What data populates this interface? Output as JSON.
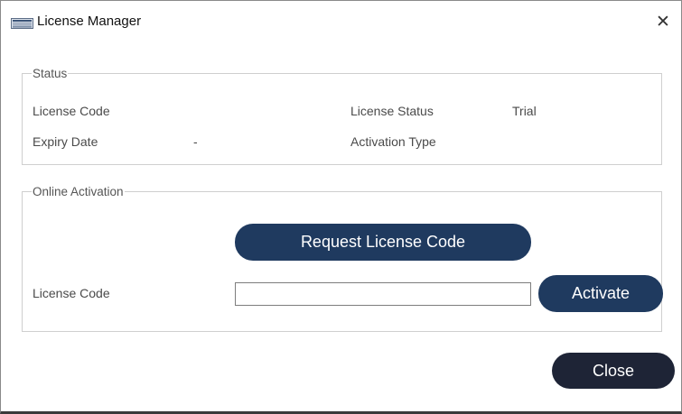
{
  "window": {
    "title": "License Manager",
    "close_glyph": "✕"
  },
  "status": {
    "legend": "Status",
    "license_code_label": "License Code",
    "license_code_value": "",
    "license_status_label": "License Status",
    "license_status_value": "Trial",
    "expiry_date_label": "Expiry Date",
    "expiry_date_value": "-",
    "activation_type_label": "Activation Type",
    "activation_type_value": ""
  },
  "online_activation": {
    "legend": "Online Activation",
    "request_button_label": "Request License Code",
    "license_code_label": "License Code",
    "license_code_input_value": "",
    "activate_button_label": "Activate"
  },
  "footer": {
    "close_button_label": "Close"
  },
  "colors": {
    "button_primary": "#1f3a5f",
    "button_close": "#1e2436"
  },
  "icons": {
    "app": "license-manager-app-icon",
    "close": "close-icon"
  }
}
